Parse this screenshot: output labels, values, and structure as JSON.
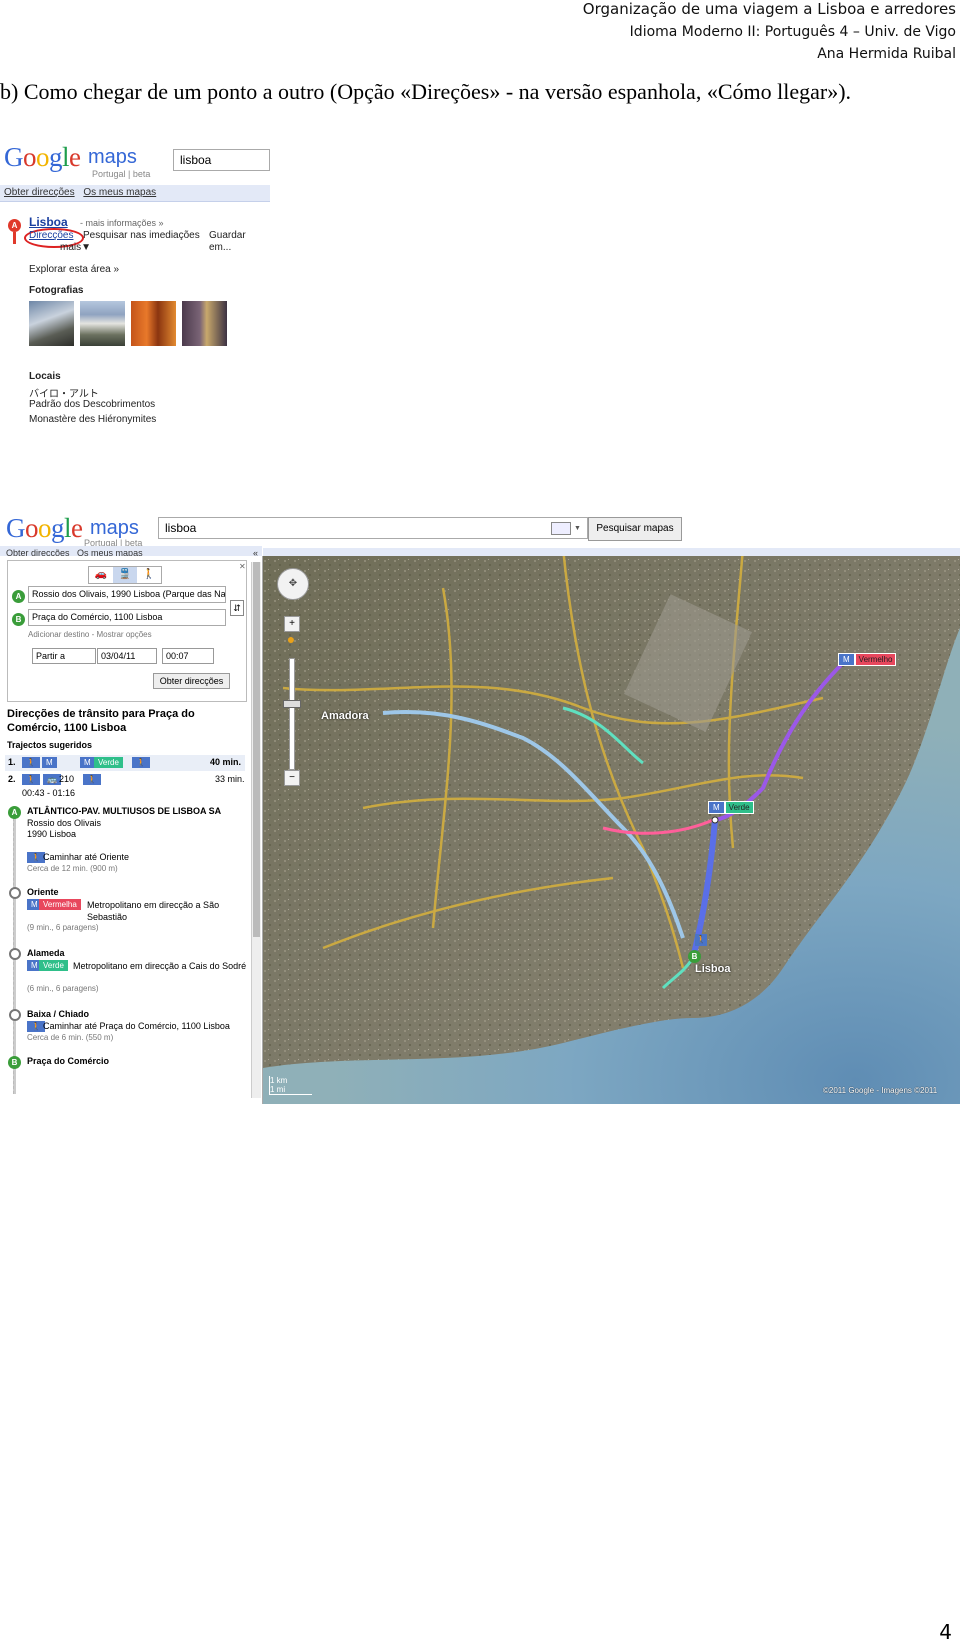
{
  "header": {
    "line1": "Organização de uma viagem a Lisboa e arredores",
    "line2": "Idioma Moderno II: Português 4 – Univ. de Vigo",
    "line3": "Ana Hermida Ruibal"
  },
  "paragraph": "b) Como chegar de um ponto a outro (Opção «Direções» - na versão espanhola, «Cómo llegar»).",
  "shot1": {
    "logo_maps": "maps",
    "logo_sub": "Portugal | beta",
    "search_value": "lisboa",
    "tab_directions": "Obter direcções",
    "tab_mymaps": "Os meus mapas",
    "marker": "A",
    "place_title": "Lisboa",
    "more_info": "- mais informações »",
    "link_directions": "Direcções",
    "link_nearby": "Pesquisar nas imediações",
    "link_save": "Guardar em...",
    "link_more": "mais▼",
    "explore": "Explorar esta área »",
    "photos_heading": "Fotografias",
    "places_heading": "Locais",
    "places": [
      "バイロ・アルト",
      "Padrão dos Descobrimentos",
      "Monastère des Hiéronymites"
    ]
  },
  "shot2": {
    "logo_maps": "maps",
    "logo_sub": "Portugal | beta",
    "search_value": "lisboa",
    "search_button": "Pesquisar mapas",
    "tab_directions": "Obter direcções",
    "tab_mymaps": "Os meus mapas",
    "collapse": "«",
    "from_marker": "A",
    "from_value": "Rossio dos Olivais, 1990 Lisboa (Parque das Na",
    "to_marker": "B",
    "to_value": "Praça do Comércio, 1100 Lisboa",
    "add_options": "Adicionar destino - Mostrar opções",
    "depart_select": "Partir a",
    "date_value": "03/04/11",
    "time_value": "00:07",
    "get_button": "Obter direcções",
    "result_title": "Direcções de trânsito para Praça do Comércio, 1100 Lisboa",
    "suggested": "Trajectos sugeridos",
    "route1_num": "1.",
    "route1_line": "Verde",
    "route1_time": "40 min.",
    "route2_num": "2.",
    "route2_bus": "210",
    "route2_time": "33 min.",
    "route2_hours": "00:43 - 01:16",
    "start_name": "ATLÂNTICO-PAV. MULTIUSOS DE LISBOA SA",
    "start_addr1": "Rossio dos Olivais",
    "start_addr2": "1990 Lisboa",
    "walk1": "Caminhar até Oriente",
    "walk1_time": "Cerca de 12 min. (900 m)",
    "stop1": "Oriente",
    "stop1_line": "Vermelha",
    "stop1_text": "Metropolitano em direcção a São Sebastião",
    "stop1_time": "(9 min., 6 paragens)",
    "stop2": "Alameda",
    "stop2_line": "Verde",
    "stop2_text": "Metropolitano em direcção a Cais do Sodré",
    "stop2_time": "(6 min., 6 paragens)",
    "stop3": "Baixa / Chiado",
    "walk2": "Caminhar até Praça do Comércio, 1100 Lisboa",
    "walk2_time": "Cerca de 6 min. (550 m)",
    "end_marker": "B",
    "end_name": "Praça do Comércio",
    "map_label_amadora": "Amadora",
    "map_label_lisboa": "Lisboa",
    "map_label_vermelho": "Vermelho",
    "map_label_verde": "Verde",
    "metro_m": "M",
    "scale_km": "1 km",
    "scale_mi": "1 mi",
    "copyright": "©2011 Google - Imagens ©2011"
  },
  "page_number": "4"
}
